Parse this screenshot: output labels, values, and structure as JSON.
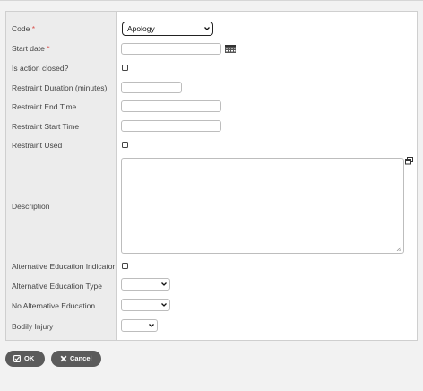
{
  "form": {
    "fields": [
      {
        "label": "Code",
        "required": true
      },
      {
        "label": "Start date",
        "required": true
      },
      {
        "label": "Is action closed?"
      },
      {
        "label": "Restraint Duration (minutes)"
      },
      {
        "label": "Restraint End Time"
      },
      {
        "label": "Restraint Start Time"
      },
      {
        "label": "Restraint Used"
      },
      {
        "label": "Description"
      },
      {
        "label": "Alternative Education Indicator"
      },
      {
        "label": "Alternative Education Type"
      },
      {
        "label": "No Alternative Education"
      },
      {
        "label": "Bodily Injury"
      }
    ],
    "required_marker": "*",
    "code_selected": "Apology"
  },
  "buttons": {
    "ok_label": "OK",
    "cancel_label": "Cancel"
  },
  "colors": {
    "required": "#d9534f",
    "button": "#5b5b5b",
    "label_bg": "#ececec"
  },
  "icons": [
    "calendar-icon",
    "expand-icon",
    "chevron-down-icon",
    "check-square-icon",
    "close-icon",
    "resize-grip-icon"
  ]
}
